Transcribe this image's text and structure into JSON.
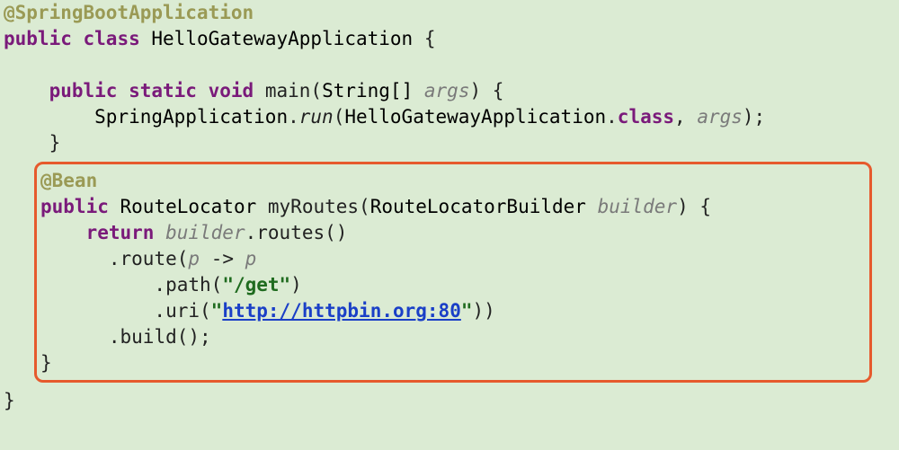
{
  "annotation_app": "@SpringBootApplication",
  "kw_public": "public",
  "kw_class": "class",
  "class_name": "HelloGatewayApplication",
  "brace_open": "{",
  "brace_close": "}",
  "kw_static": "static",
  "kw_void": "void",
  "main_name": "main",
  "main_param_type": "String[]",
  "main_param_name": "args",
  "spring_app": "SpringApplication",
  "run_call": "run",
  "class_ref": "HelloGatewayApplication",
  "dot_class": "class",
  "args_ref": "args",
  "annotation_bean": "@Bean",
  "ret_type": "RouteLocator",
  "method_name": "myRoutes",
  "param_type": "RouteLocatorBuilder",
  "param_name": "builder",
  "kw_return": "return",
  "builder_ref": "builder",
  "routes_call": "routes",
  "route_call": "route",
  "lambda_p1": "p",
  "arrow": "->",
  "lambda_p2": "p",
  "path_call": "path",
  "path_arg": "\"/get\"",
  "uri_call": "uri",
  "uri_q1": "\"",
  "uri_url": "http://httpbin.org:80",
  "uri_q2": "\"",
  "build_call": "build"
}
